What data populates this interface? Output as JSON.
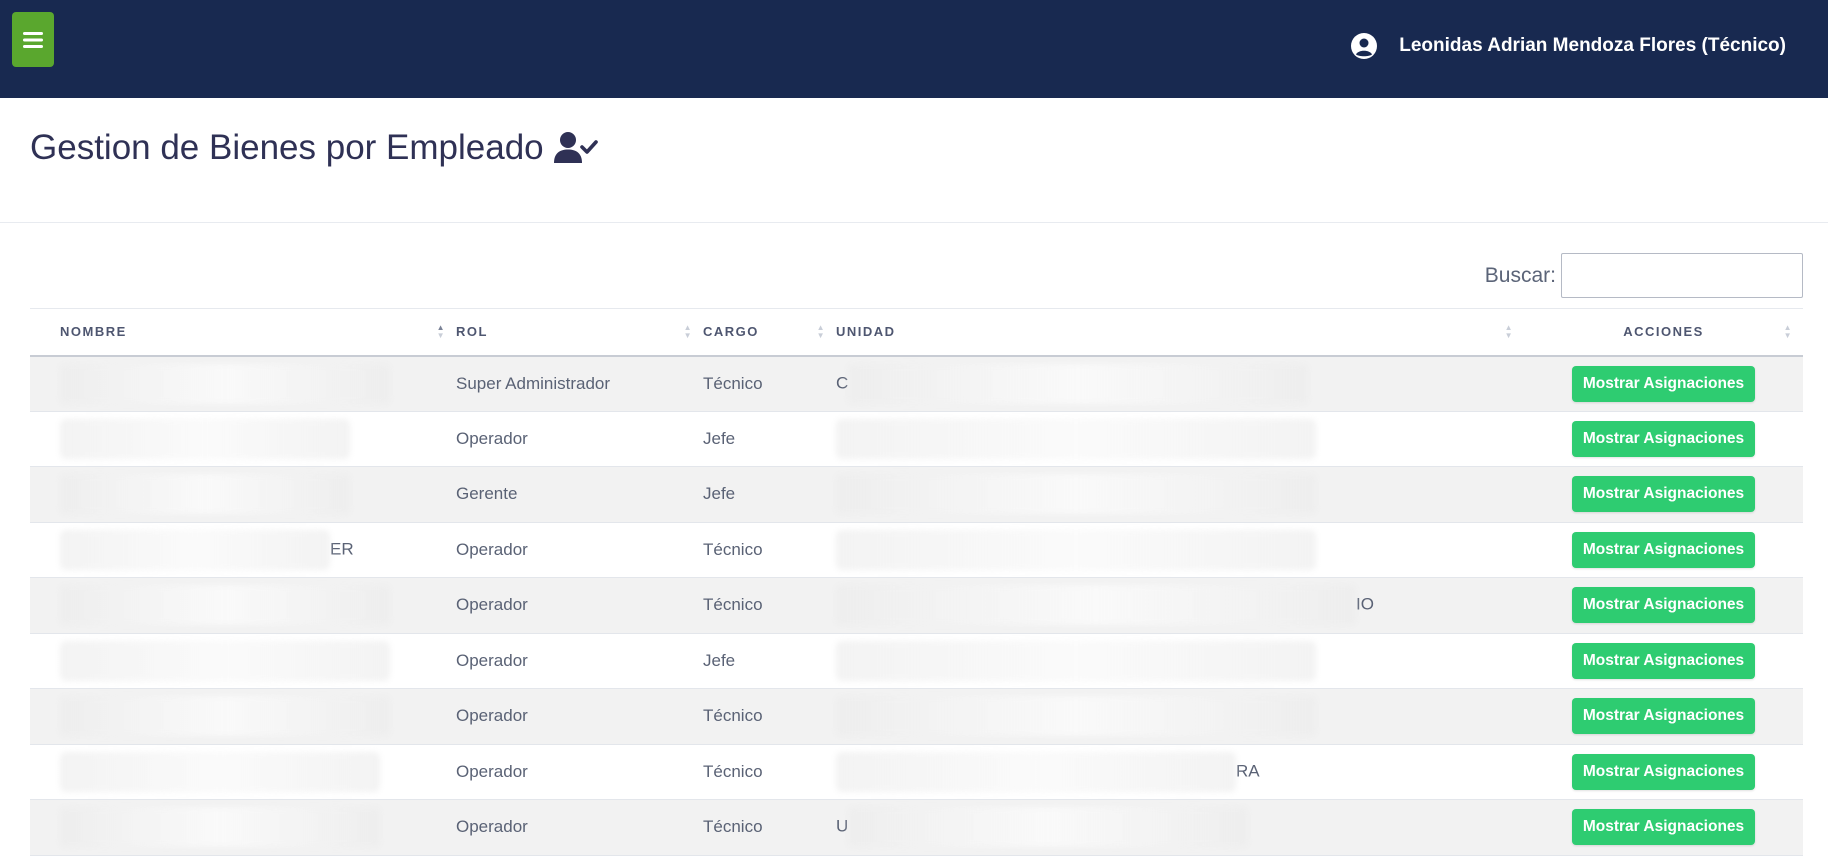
{
  "topbar": {
    "menu_icon": "hamburger-icon",
    "user_icon": "user-circle-icon",
    "user_name": "Leonidas Adrian Mendoza Flores (Técnico)"
  },
  "page": {
    "title": "Gestion de Bienes por Empleado",
    "title_icon": "user-check-icon"
  },
  "search": {
    "label": "Buscar:",
    "value": ""
  },
  "table": {
    "columns": [
      "NOMBRE",
      "ROL",
      "CARGO",
      "UNIDAD",
      "ACCIONES"
    ],
    "sorted_column": "NOMBRE",
    "action_label": "Mostrar Asignaciones",
    "rows": [
      {
        "nombre": "",
        "rol": "Super Administrador",
        "cargo": "Técnico",
        "unidad": "C"
      },
      {
        "nombre": "",
        "rol": "Operador",
        "cargo": "Jefe",
        "unidad": ""
      },
      {
        "nombre": "",
        "rol": "Gerente",
        "cargo": "Jefe",
        "unidad": ""
      },
      {
        "nombre": "ER",
        "rol": "Operador",
        "cargo": "Técnico",
        "unidad": ""
      },
      {
        "nombre": "",
        "rol": "Operador",
        "cargo": "Técnico",
        "unidad": "IO"
      },
      {
        "nombre": "",
        "rol": "Operador",
        "cargo": "Jefe",
        "unidad": ""
      },
      {
        "nombre": "",
        "rol": "Operador",
        "cargo": "Técnico",
        "unidad": ""
      },
      {
        "nombre": "",
        "rol": "Operador",
        "cargo": "Técnico",
        "unidad": "RA"
      },
      {
        "nombre": "",
        "rol": "Operador",
        "cargo": "Técnico",
        "unidad": "U"
      }
    ]
  },
  "colors": {
    "topbar": "#182950",
    "menu_button": "#5aa72e",
    "action_button": "#2ecc71",
    "title": "#2f3155"
  }
}
